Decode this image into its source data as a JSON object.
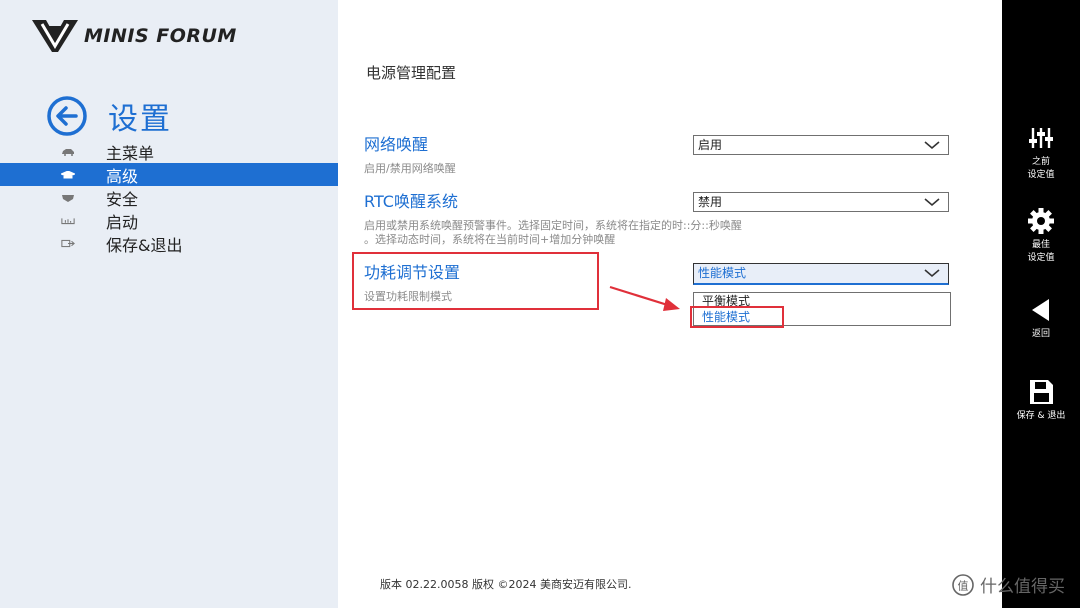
{
  "brand": {
    "logo_text": "MINIS FORUM"
  },
  "header": {
    "title": "设置"
  },
  "sidebar": {
    "items": [
      {
        "label": "主菜单",
        "icon": "car-icon",
        "selected": false
      },
      {
        "label": "高级",
        "icon": "graduation-cap-icon",
        "selected": true
      },
      {
        "label": "安全",
        "icon": "shield-icon",
        "selected": false
      },
      {
        "label": "启动",
        "icon": "boot-icon",
        "selected": false
      },
      {
        "label": "保存&退出",
        "icon": "exit-icon",
        "selected": false
      }
    ]
  },
  "main": {
    "section_title": "电源管理配置",
    "settings": [
      {
        "label": "网络唤醒",
        "desc": "启用/禁用网络唤醒",
        "value": "启用"
      },
      {
        "label": "RTC唤醒系统",
        "desc_line1": "启用或禁用系统唤醒预警事件。选择固定时间，系统将在指定的时::分::秒唤醒",
        "desc_line2": "。选择动态时间，系统将在当前时间+增加分钟唤醒",
        "value": "禁用"
      },
      {
        "label": "功耗调节设置",
        "desc": "设置功耗限制模式",
        "value": "性能模式"
      }
    ],
    "dropdown_options": [
      "平衡模式",
      "性能模式"
    ],
    "footer": "版本 02.22.0058 版权 ©2024 美商安迈有限公司."
  },
  "rightbar": {
    "items": [
      {
        "label_line1": "之前",
        "label_line2": "设定值",
        "icon": "sliders-icon"
      },
      {
        "label_line1": "最佳",
        "label_line2": "设定值",
        "icon": "gear-icon"
      },
      {
        "label_line1": "返回",
        "label_line2": "",
        "icon": "back-triangle-icon"
      },
      {
        "label_line1": "保存 & 退出",
        "label_line2": "",
        "icon": "floppy-icon"
      }
    ]
  },
  "watermark": {
    "text": "什么值得买",
    "icon_char": "值"
  },
  "colors": {
    "accent": "#1e6fd2",
    "highlight_box": "#e0303a",
    "sidebar_bg": "#e9eef5",
    "rightbar_bg": "#000000"
  }
}
